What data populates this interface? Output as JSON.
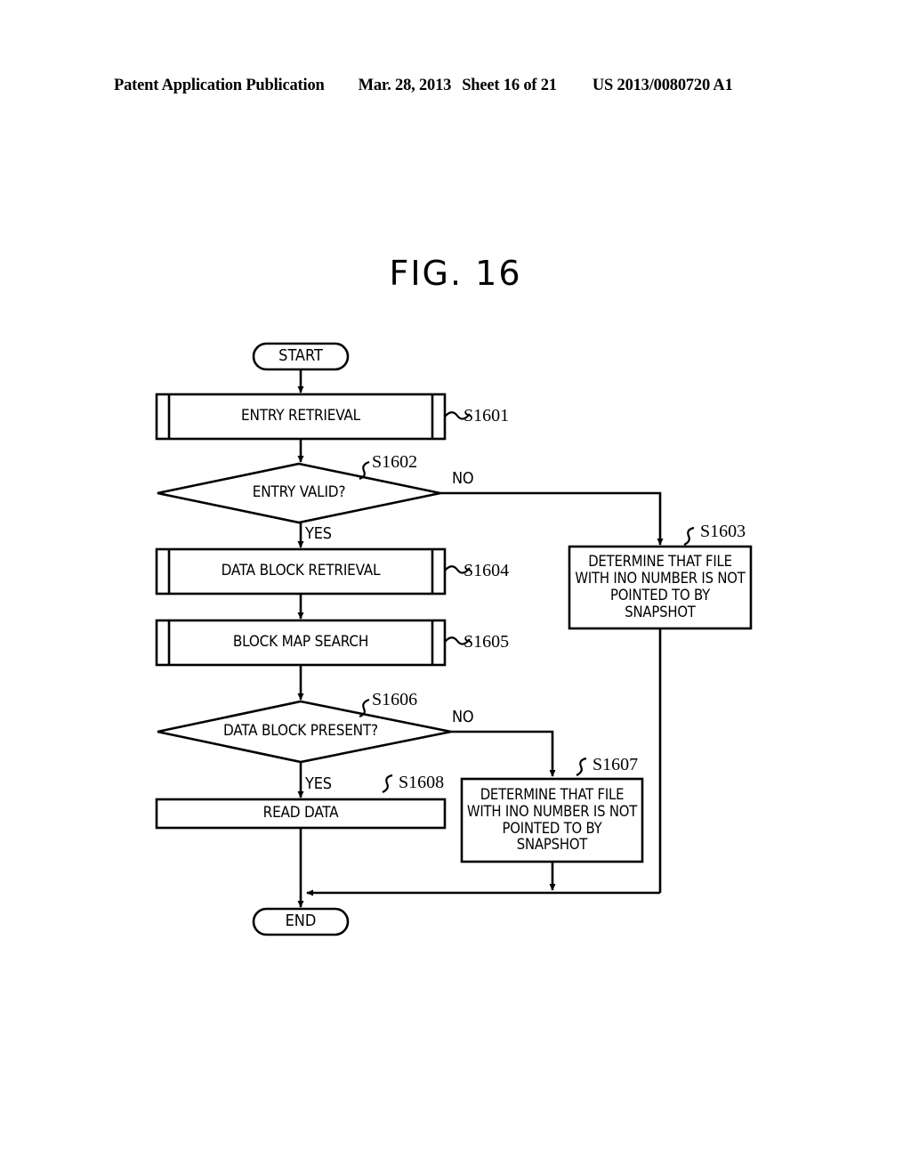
{
  "header": {
    "publication": "Patent Application Publication",
    "date": "Mar. 28, 2013",
    "sheet": "Sheet 16 of 21",
    "patent_number": "US 2013/0080720 A1"
  },
  "figure": {
    "title": "FIG.  16"
  },
  "flowchart": {
    "nodes": {
      "start": {
        "label": "START",
        "shape": "terminator"
      },
      "s1601": {
        "label": "ENTRY RETRIEVAL",
        "shape": "predefined-process",
        "step": "S1601"
      },
      "s1602": {
        "label": "ENTRY VALID?",
        "shape": "decision",
        "step": "S1602"
      },
      "s1603": {
        "label": "DETERMINE THAT FILE\nWITH INO NUMBER IS NOT\nPOINTED TO BY\nSNAPSHOT",
        "shape": "process",
        "step": "S1603"
      },
      "s1604": {
        "label": "DATA BLOCK RETRIEVAL",
        "shape": "predefined-process",
        "step": "S1604"
      },
      "s1605": {
        "label": "BLOCK MAP SEARCH",
        "shape": "predefined-process",
        "step": "S1605"
      },
      "s1606": {
        "label": "DATA BLOCK PRESENT?",
        "shape": "decision",
        "step": "S1606"
      },
      "s1607": {
        "label": "DETERMINE THAT FILE\nWITH INO NUMBER IS NOT\nPOINTED TO BY\nSNAPSHOT",
        "shape": "process",
        "step": "S1607"
      },
      "s1608": {
        "label": "READ DATA",
        "shape": "process",
        "step": "S1608"
      },
      "end": {
        "label": "END",
        "shape": "terminator"
      }
    },
    "branches": {
      "s1602_yes": "YES",
      "s1602_no": "NO",
      "s1606_yes": "YES",
      "s1606_no": "NO"
    },
    "colors": {
      "stroke": "#000000",
      "fill": "#ffffff",
      "background": "#ffffff"
    }
  }
}
